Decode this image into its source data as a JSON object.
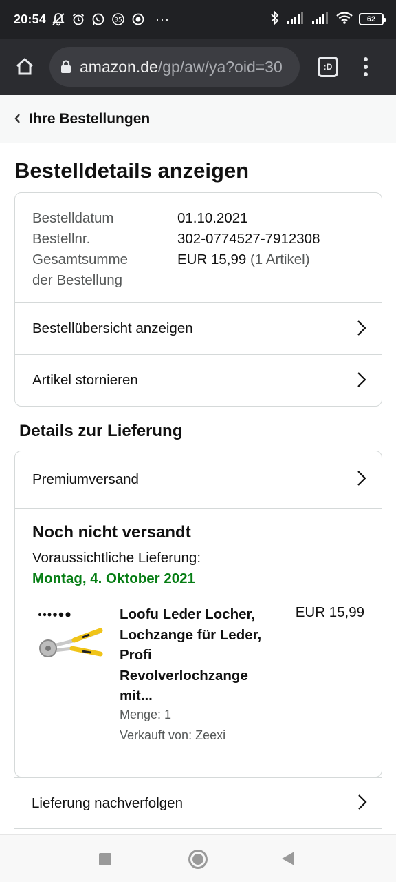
{
  "status_bar": {
    "time": "20:54",
    "left_icons": [
      "bell-off-icon",
      "alarm-icon",
      "whatsapp-icon",
      "badge-35-icon",
      "target-icon"
    ],
    "badge_35": "35",
    "more": "···",
    "battery": "62"
  },
  "browser": {
    "url_host": "amazon.de",
    "url_path": "/gp/aw/ya?oid=30",
    "tabs_label": ":D"
  },
  "back_header": {
    "label": "Ihre Bestellungen"
  },
  "page": {
    "title": "Bestelldetails anzeigen",
    "order": {
      "date_label": "Bestelldatum",
      "date_value": "01.10.2021",
      "number_label": "Bestellnr.",
      "number_value": "302-0774527-7912308",
      "total_label_line1": "Gesamtsumme",
      "total_label_line2": "der Bestellung",
      "total_value": "EUR 15,99",
      "total_count": "(1 Artikel)"
    },
    "order_actions": [
      {
        "label": "Bestellübersicht anzeigen"
      },
      {
        "label": "Artikel stornieren"
      }
    ],
    "delivery": {
      "section_title": "Details zur Lieferung",
      "shipping_method": "Premiumversand",
      "status": "Noch nicht versandt",
      "eta_label": "Voraussichtliche Lieferung:",
      "eta_date": "Montag, 4. Oktober 2021",
      "item": {
        "title": "Loofu Leder Locher, Lochzange für Leder, Profi Revolverlochzange mit...",
        "price": "EUR 15,99",
        "quantity": "Menge: 1",
        "seller": "Verkauft von: Zeexi"
      },
      "track_label": "Lieferung nachverfolgen"
    }
  },
  "colors": {
    "eta_green": "#067d14",
    "toolbar_bg": "#2b2c30",
    "status_bg": "#202124"
  }
}
